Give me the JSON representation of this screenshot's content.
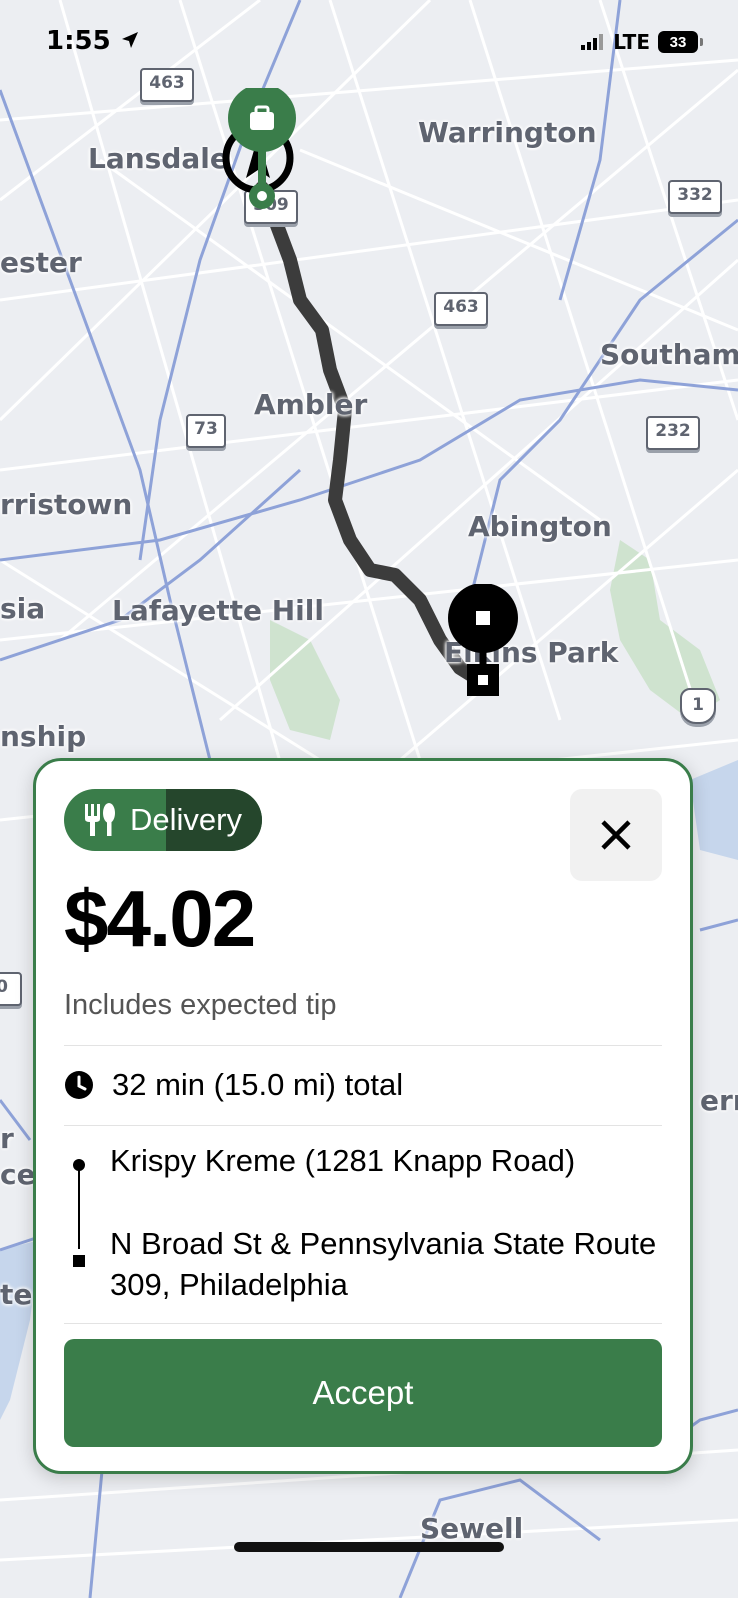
{
  "status_bar": {
    "time": "1:55",
    "network": "LTE",
    "battery": "33"
  },
  "map": {
    "places": {
      "lansdale": "Lansdale",
      "warrington": "Warrington",
      "chester": "ester",
      "southampton": "Southam",
      "ambler": "Ambler",
      "norristown": "rristown",
      "abington": "Abington",
      "lafayette_hill": "Lafayette Hill",
      "conshohocken": "sia",
      "elkins_park": "Elkins Park",
      "township": "nship",
      "sewell": "Sewell",
      "left_r": "r",
      "left_ce": "ce",
      "left_te": "te",
      "right_err": "err"
    },
    "shields": {
      "r463_top": "463",
      "r309": "309",
      "r332": "332",
      "r463_mid": "463",
      "r73": "73",
      "r232": "232",
      "us1": "1",
      "r0": "0"
    },
    "colors": {
      "route": "#3c3c3c",
      "pickup_pin": "#3a7d4a",
      "dropoff_pin": "#000000"
    }
  },
  "offer": {
    "type_label": "Delivery",
    "price": "$4.02",
    "price_note": "Includes expected tip",
    "eta": "32 min (15.0 mi) total",
    "pickup": "Krispy Kreme (1281 Knapp Road)",
    "dropoff": "N Broad St & Pennsylvania State Route 309, Philadelphia",
    "accept_label": "Accept",
    "accent_color": "#3a7d4a"
  }
}
